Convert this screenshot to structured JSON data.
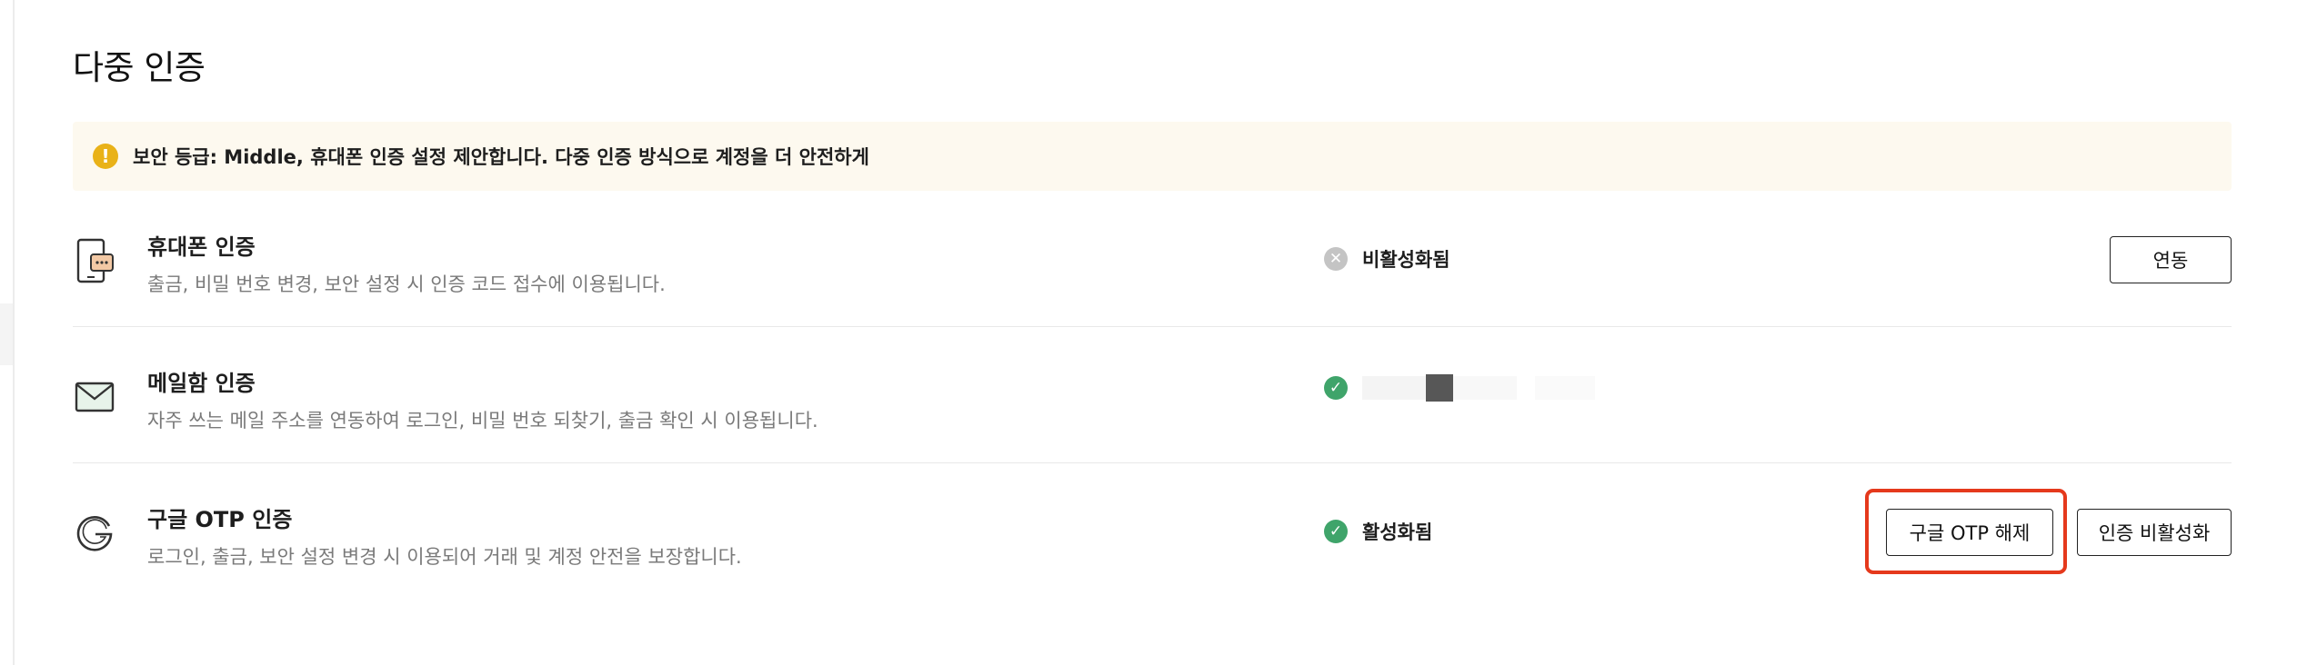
{
  "page": {
    "title": "다중 인증"
  },
  "notice": {
    "text": "보안 등급: Middle, 휴대폰 인증 설정 제안합니다. 다중 인증 방식으로 계정을 더 안전하게"
  },
  "methods": [
    {
      "title": "휴대폰 인증",
      "description": "출금, 비밀 번호 변경, 보안 설정 시 인증 코드 접수에 이용됩니다.",
      "status": "비활성화됨",
      "status_type": "inactive",
      "icon": "phone-icon",
      "button_label": "연동"
    },
    {
      "title": "메일함 인증",
      "description": "자주 쓰는 메일 주소를 연동하여 로그인, 비밀 번호 되찾기, 출금 확인 시 이용됩니다.",
      "status_type": "active",
      "icon": "mail-icon"
    },
    {
      "title": "구글 OTP 인증",
      "description": "로그인, 출금, 보안 설정 변경 시 이용되어 거래 및 계정 안전을 보장합니다.",
      "status": "활성화됨",
      "status_type": "active",
      "icon": "google-icon",
      "buttons": [
        "구글 OTP 해제",
        "인증 비활성화"
      ]
    }
  ],
  "colors": {
    "notice_bg": "#fdf9ef",
    "warning": "#e9b218",
    "active": "#3fa46a",
    "inactive": "#c4c4c4",
    "highlight": "#e5391c"
  }
}
